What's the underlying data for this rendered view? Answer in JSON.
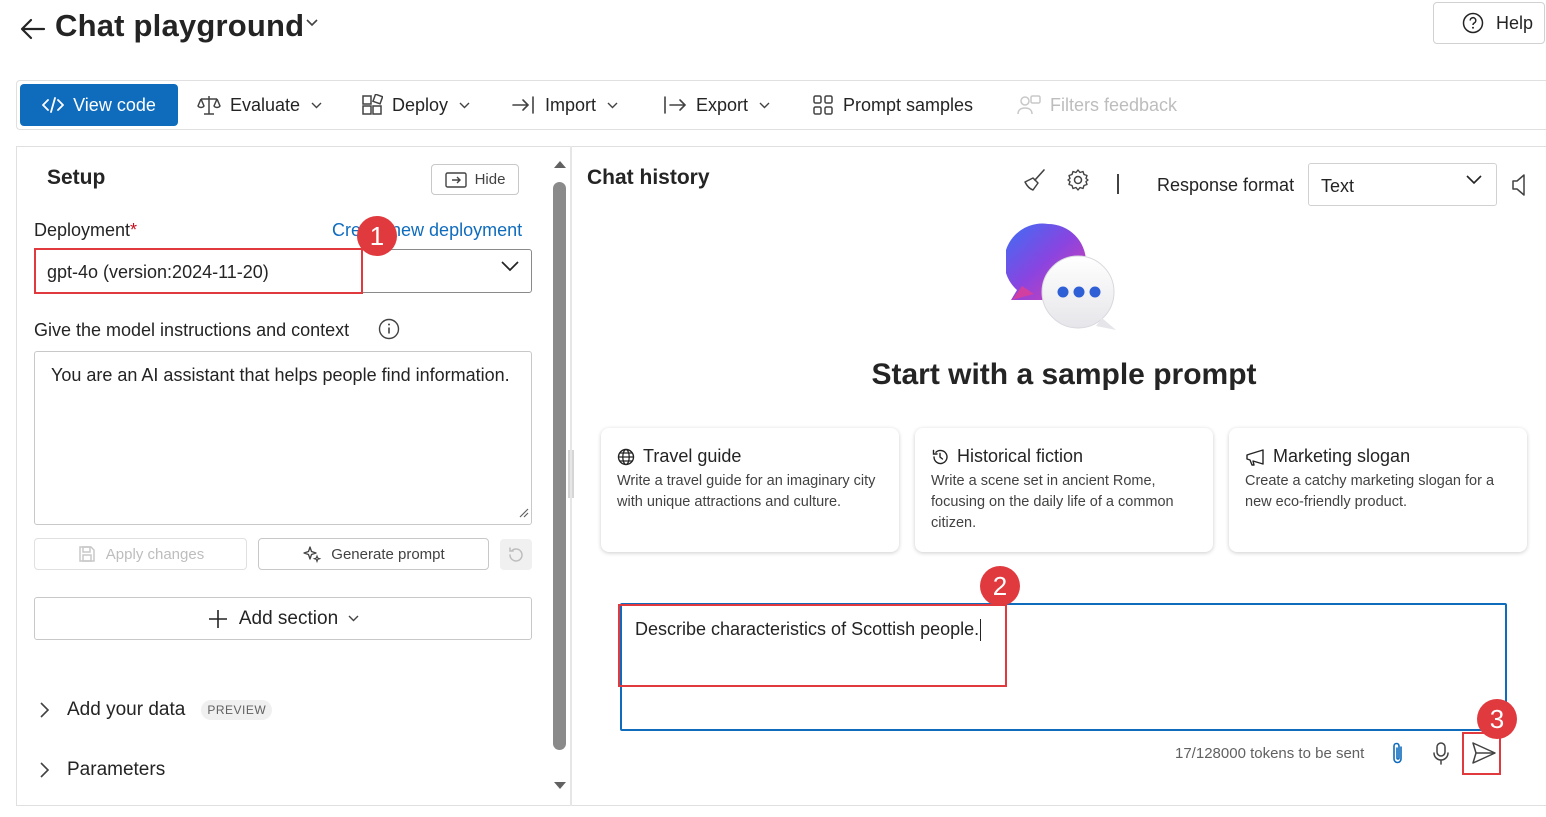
{
  "header": {
    "title": "Chat playground",
    "help_label": "Help"
  },
  "toolbar": {
    "view_code": "View code",
    "evaluate": "Evaluate",
    "deploy": "Deploy",
    "import": "Import",
    "export": "Export",
    "prompt_samples": "Prompt samples",
    "filters_feedback": "Filters feedback"
  },
  "setup": {
    "title": "Setup",
    "hide_label": "Hide",
    "deployment_label": "Deployment",
    "required_mark": "*",
    "create_link": "Create new deployment",
    "deployment_value": "gpt-4o (version:2024-11-20)",
    "instructions_label": "Give the model instructions and context",
    "instructions_value": "You are an AI assistant that helps people find information.",
    "apply_label": "Apply changes",
    "generate_label": "Generate prompt",
    "add_section_label": "Add section",
    "add_data_label": "Add your data",
    "preview_badge": "PREVIEW",
    "parameters_label": "Parameters"
  },
  "chat": {
    "title": "Chat history",
    "response_format_label": "Response format",
    "response_format_value": "Text",
    "sample_heading": "Start with a sample prompt",
    "cards": [
      {
        "title": "Travel guide",
        "desc": "Write a travel guide for an imaginary city with unique attractions and culture.",
        "icon": "globe-icon"
      },
      {
        "title": "Historical fiction",
        "desc": "Write a scene set in ancient Rome, focusing on the daily life of a common citizen.",
        "icon": "history-icon"
      },
      {
        "title": "Marketing slogan",
        "desc": "Create a catchy marketing slogan for a new eco-friendly product.",
        "icon": "megaphone-icon"
      }
    ],
    "input_value": "Describe characteristics of Scottish people.",
    "tokens_text": "17/128000 tokens to be sent"
  },
  "annotations": {
    "step1": "1",
    "step2": "2",
    "step3": "3"
  },
  "colors": {
    "accent": "#0f6cbd",
    "annotation": "#e0393e"
  }
}
